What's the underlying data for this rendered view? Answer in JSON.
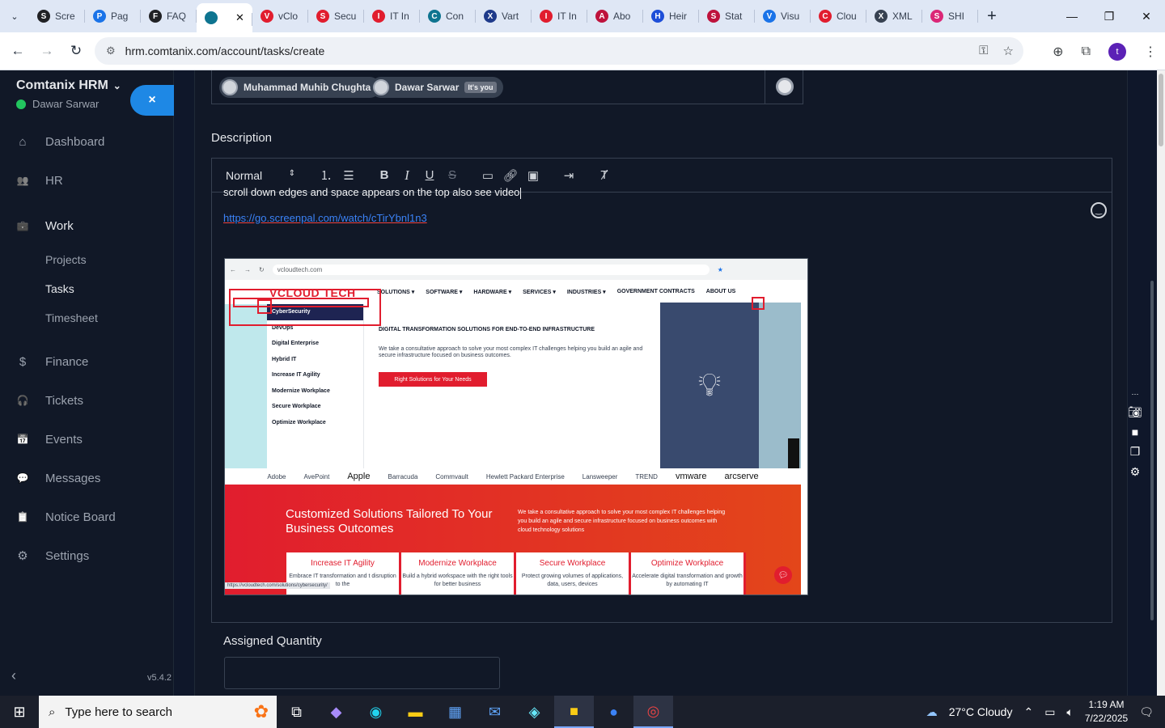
{
  "browser": {
    "tabs": [
      {
        "label": "Scre",
        "fav": "S",
        "color": "#202124"
      },
      {
        "label": "Pag",
        "fav": "P",
        "color": "#1a73e8"
      },
      {
        "label": "FAQ",
        "fav": "F",
        "color": "#202124"
      },
      {
        "label": "",
        "fav": "",
        "color": "#0e7490",
        "active": true
      },
      {
        "label": "vClo",
        "fav": "V",
        "color": "#e11d2e"
      },
      {
        "label": "Secu",
        "fav": "S",
        "color": "#e11d2e"
      },
      {
        "label": "IT In",
        "fav": "I",
        "color": "#e11d2e"
      },
      {
        "label": "Con",
        "fav": "C",
        "color": "#0e7490"
      },
      {
        "label": "Vart",
        "fav": "X",
        "color": "#1e3a8a"
      },
      {
        "label": "IT In",
        "fav": "I",
        "color": "#e11d2e"
      },
      {
        "label": "Abo",
        "fav": "A",
        "color": "#be123c"
      },
      {
        "label": "Heir",
        "fav": "H",
        "color": "#1d4ed8"
      },
      {
        "label": "Stat",
        "fav": "S",
        "color": "#be123c"
      },
      {
        "label": "Visu",
        "fav": "V",
        "color": "#1a73e8"
      },
      {
        "label": "Clou",
        "fav": "C",
        "color": "#e11d2e"
      },
      {
        "label": "XML",
        "fav": "X",
        "color": "#374151"
      },
      {
        "label": "SHI",
        "fav": "S",
        "color": "#db2777"
      }
    ],
    "url": "hrm.comtanix.com/account/tasks/create",
    "profile_initial": "t"
  },
  "sidebar": {
    "brand": "Comtanix HRM",
    "user": "Dawar Sarwar",
    "close_icon": "×",
    "items": [
      {
        "label": "Dashboard",
        "icon": "⌂"
      },
      {
        "label": "HR",
        "icon": "👥"
      },
      {
        "label": "Work",
        "icon": "💼"
      },
      {
        "label": "Finance",
        "icon": "$"
      },
      {
        "label": "Tickets",
        "icon": "🎧"
      },
      {
        "label": "Events",
        "icon": "📅"
      },
      {
        "label": "Messages",
        "icon": "💬"
      },
      {
        "label": "Notice Board",
        "icon": "📋"
      },
      {
        "label": "Settings",
        "icon": "⚙"
      }
    ],
    "work_sub": [
      "Projects",
      "Tasks",
      "Timesheet"
    ],
    "version": "v5.4.2"
  },
  "form": {
    "assignees": [
      {
        "name": "Muhammad Muhib Chughtai"
      },
      {
        "name": "Dawar Sarwar",
        "badge": "It's you"
      }
    ],
    "description_label": "Description",
    "toolbar": {
      "format": "Normal"
    },
    "description_text": "scroll down edges and space appears on the top  also see video",
    "description_link": "https://go.screenpal.com/watch/cTirYbnl1n3",
    "assigned_quantity_label": "Assigned Quantity",
    "assigned_quantity_value": ""
  },
  "embedded_screenshot": {
    "url": "vcloudtech.com",
    "logo": "VCLOUD TECH",
    "nav": [
      "SOLUTIONS ▾",
      "SOFTWARE ▾",
      "HARDWARE ▾",
      "SERVICES ▾",
      "INDUSTRIES ▾",
      "GOVERNMENT CONTRACTS",
      "ABOUT US"
    ],
    "dropdown": [
      "CyberSecurity",
      "DevOps",
      "Digital Enterprise",
      "Hybrid IT",
      "Increase IT Agility",
      "Modernize Workplace",
      "Secure Workplace",
      "Optimize Workplace"
    ],
    "hero_title": "DIGITAL TRANSFORMATION SOLUTIONS FOR END-TO-END INFRASTRUCTURE",
    "hero_text": "We take a consultative approach to solve your most complex IT challenges helping you build an agile and secure infrastructure focused on business outcomes.",
    "hero_button": "Right Solutions for Your Needs",
    "partners": [
      "Adobe",
      "AvePoint",
      "Apple",
      "Barracuda",
      "Commvault",
      "Hewlett Packard Enterprise",
      "Lansweeper",
      "TREND",
      "vmware",
      "arcserve"
    ],
    "banner_title": "Customized Solutions Tailored To Your Business Outcomes",
    "banner_text": "We take a consultative approach to solve your most complex IT challenges helping you build an agile and secure infrastructure focused on business outcomes with cloud technology solutions",
    "cards": [
      {
        "title": "Increase IT Agility",
        "text": "Embrace IT transformation and t disruption to the"
      },
      {
        "title": "Modernize Workplace",
        "text": "Build a hybrid workspace with the right tools for better business"
      },
      {
        "title": "Secure Workplace",
        "text": "Protect growing volumes of applications, data, users, devices"
      },
      {
        "title": "Optimize Workplace",
        "text": "Accelerate digital transformation and growth by automating IT"
      }
    ],
    "status_url": "https://vcloudtech.com/solutions/cybersecurity/"
  },
  "taskbar": {
    "search_placeholder": "Type here to search",
    "weather": "27°C  Cloudy",
    "time": "1:19 AM",
    "date": "7/22/2025"
  }
}
